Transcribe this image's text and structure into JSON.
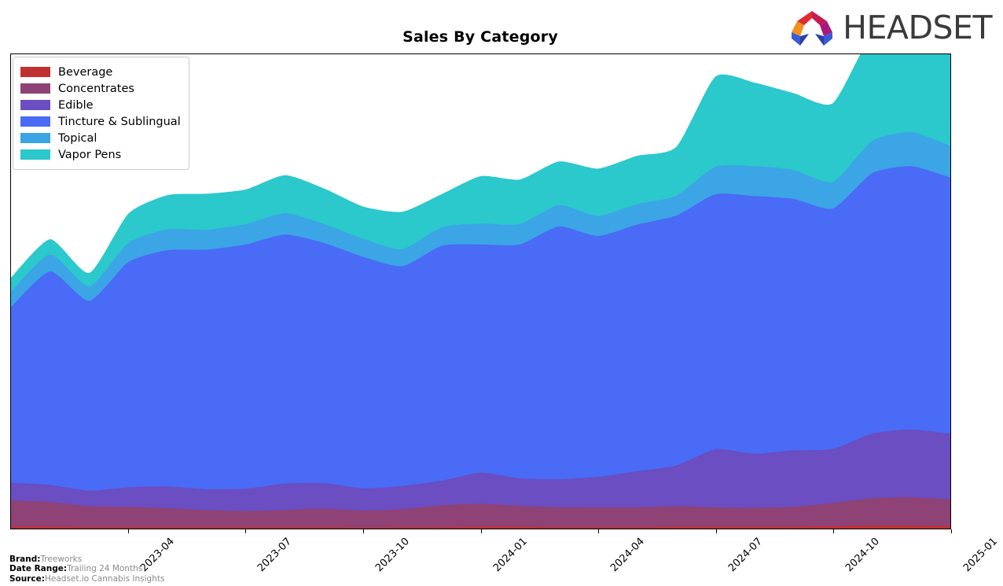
{
  "header": {
    "title": "Sales By Category",
    "logo_text": "HEADSET",
    "logo_icon": "headset-arch-logo",
    "logo_colors": [
      "#F0911E",
      "#E02B33",
      "#C71A52",
      "#A8197E",
      "#3A5BD9",
      "#2E3FA8"
    ]
  },
  "legend": {
    "position": "upper-left",
    "items": [
      {
        "label": "Beverage",
        "color": "#C23131"
      },
      {
        "label": "Concentrates",
        "color": "#8E4276"
      },
      {
        "label": "Edible",
        "color": "#6A4EC2"
      },
      {
        "label": "Tincture & Sublingual",
        "color": "#4A6BF5"
      },
      {
        "label": "Topical",
        "color": "#3BA5E6"
      },
      {
        "label": "Vapor Pens",
        "color": "#2BC8CC"
      }
    ]
  },
  "footer": {
    "rows": [
      {
        "key": "Brand:",
        "value": "Treeworks"
      },
      {
        "key": "Date Range:",
        "value": "Trailing 24 Months"
      },
      {
        "key": "Source:",
        "value": "Headset.io Cannabis Insights"
      }
    ]
  },
  "chart_data": {
    "type": "area",
    "stacked": true,
    "title": "Sales By Category",
    "xlabel": "",
    "ylabel": "",
    "grid": false,
    "legend_position": "upper-left",
    "axis_tick_labels": [
      "2023-04",
      "2023-07",
      "2023-10",
      "2024-01",
      "2024-04",
      "2024-07",
      "2024-10",
      "2025-01"
    ],
    "x": [
      "2023-01",
      "2023-02",
      "2023-03",
      "2023-04",
      "2023-05",
      "2023-06",
      "2023-07",
      "2023-08",
      "2023-09",
      "2023-10",
      "2023-11",
      "2023-12",
      "2024-01",
      "2024-02",
      "2024-03",
      "2024-04",
      "2024-05",
      "2024-06",
      "2024-07",
      "2024-08",
      "2024-09",
      "2024-10",
      "2024-11",
      "2024-12",
      "2025-01"
    ],
    "ylim": [
      0,
      100
    ],
    "series": [
      {
        "name": "Beverage",
        "color": "#C23131",
        "values": [
          0.4,
          0.4,
          0.3,
          0.3,
          0.3,
          0.3,
          0.3,
          0.3,
          0.3,
          0.2,
          0.3,
          0.3,
          0.4,
          0.4,
          0.3,
          0.3,
          0.3,
          0.4,
          0.4,
          0.4,
          0.4,
          0.5,
          0.6,
          0.6,
          0.5
        ]
      },
      {
        "name": "Concentrates",
        "color": "#8E4276",
        "values": [
          5.5,
          5.2,
          4.4,
          4.3,
          4.0,
          3.6,
          3.4,
          3.6,
          3.9,
          3.6,
          3.8,
          4.6,
          4.8,
          4.4,
          4.2,
          4.2,
          4.2,
          4.3,
          4.1,
          4.0,
          4.2,
          4.9,
          5.8,
          6.0,
          5.7
        ]
      },
      {
        "name": "Edible",
        "color": "#6A4EC2",
        "values": [
          3.8,
          3.6,
          3.3,
          4.1,
          4.6,
          4.4,
          4.7,
          5.6,
          5.4,
          4.7,
          4.9,
          5.2,
          6.6,
          5.8,
          5.9,
          6.4,
          7.6,
          8.6,
          12.2,
          11.4,
          11.9,
          11.4,
          13.6,
          14.3,
          13.8
        ]
      },
      {
        "name": "Tincture & Sublingual",
        "color": "#4A6BF5",
        "values": [
          37.0,
          45.0,
          40.0,
          47.5,
          49.8,
          50.5,
          51.5,
          52.5,
          50.6,
          48.8,
          46.3,
          49.5,
          48.1,
          49.3,
          53.3,
          50.8,
          52.0,
          52.7,
          53.8,
          54.3,
          53.0,
          50.7,
          54.9,
          55.5,
          54.0
        ]
      },
      {
        "name": "Topical",
        "color": "#3BA5E6",
        "values": [
          3.2,
          3.6,
          3.1,
          4.0,
          4.4,
          4.2,
          4.3,
          4.5,
          4.0,
          3.8,
          3.6,
          3.9,
          4.4,
          4.3,
          4.5,
          4.2,
          4.3,
          4.2,
          5.8,
          6.3,
          6.1,
          5.6,
          6.8,
          7.2,
          6.7
        ]
      },
      {
        "name": "Vapor Pens",
        "color": "#2BC8CC",
        "values": [
          3.0,
          3.2,
          2.8,
          6.2,
          7.2,
          7.6,
          7.3,
          8.0,
          7.5,
          6.8,
          7.9,
          7.0,
          10.0,
          9.4,
          9.2,
          10.0,
          10.2,
          10.3,
          19.0,
          17.6,
          16.2,
          16.6,
          22.6,
          24.6,
          23.0
        ]
      }
    ]
  }
}
